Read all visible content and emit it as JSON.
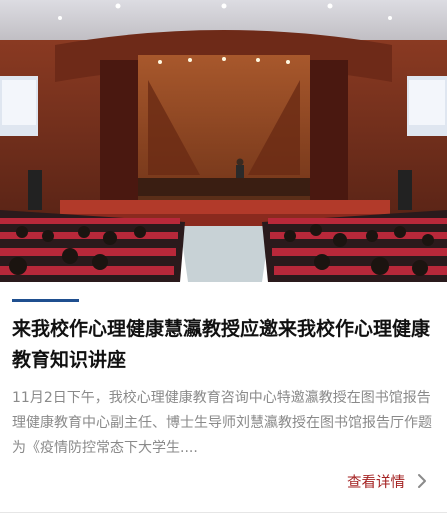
{
  "article": {
    "title": "来我校作心理健康慧瀛教授应邀来我校作心理健康教育知识讲座",
    "summary": "11月2日下午，我校心理健康教育咨询中心特邀瀛教授在图书馆报告理健康教育中心副主任、博士生导师刘慧瀛教授在图书馆报告厅作题为《疫情防控常态下大学生....",
    "more_label": "查看详情",
    "accent_color": "#1f4f8f",
    "link_color": "#a42222"
  },
  "icons": {
    "more": "chevron-right-icon"
  }
}
